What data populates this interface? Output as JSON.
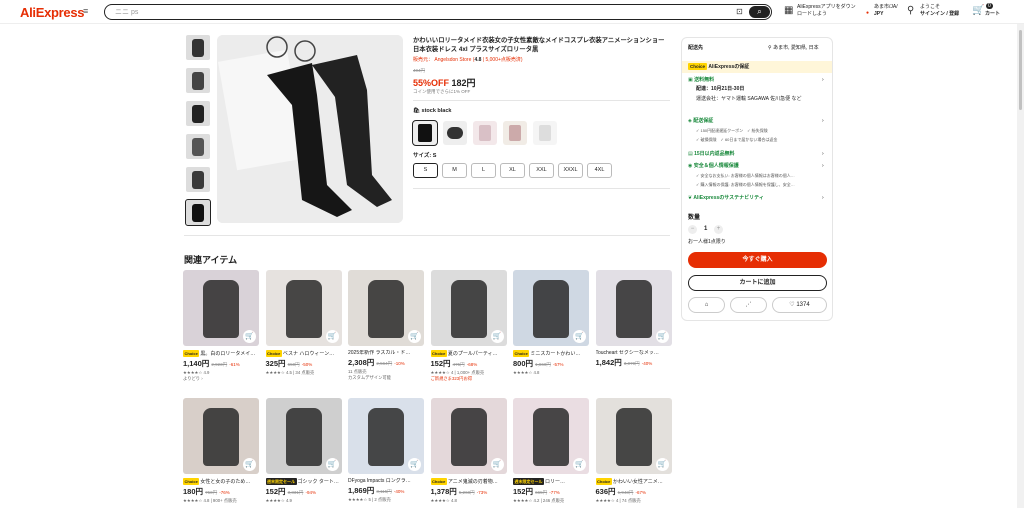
{
  "header": {
    "logo": "AliExpress",
    "search_placeholder": "ニニ ps",
    "app_promo_line1": "AliExpressアプリをダウン",
    "app_promo_line2": "ロードしよう",
    "region_line1": "あま市/JA/",
    "region_line2": "JPY",
    "account_line1": "ようこそ",
    "account_line2": "サインイン / 登録",
    "cart_count": "0",
    "cart_label": "カート"
  },
  "product": {
    "title": "かわいいロリータメイド衣装女の子女性素敵なメイドコスプレ衣装アニメーションショー日本衣装ドレス 4xl プラスサイズロリータ黒",
    "store_prefix": "販売元：",
    "store_name": "Angelsdon Store",
    "rating": "4.8",
    "sold": "5,000+点販売済",
    "original_price": "404円",
    "discount": "55%OFF",
    "price": "182円",
    "coin_note": "コイン使用でさらに1% OFF",
    "color_label": "stock black",
    "size_label": "サイズ: S",
    "sizes": [
      "S",
      "M",
      "L",
      "XL",
      "XXL",
      "XXXL",
      "4XL"
    ]
  },
  "panel": {
    "ship_to_label": "配送先",
    "ship_to_value": "あま市, 愛知県, 日本",
    "choice": "Choice",
    "guarantee": "AliExpressの保証",
    "free_shipping": "送料無料",
    "delivery": "配達：10月21日-30日",
    "carrier": "運送会社：ヤマト運輸 SAGAWA 佐川急便 など",
    "secure_delivery": "配送保証",
    "secure_item1": "150円配達遅延クーポン",
    "secure_item2": "紛失保険",
    "secure_item3": "破損保険",
    "secure_item4": "60日まで届かない場合は返金",
    "returns": "15日以内返品無料",
    "privacy": "安全＆個人情報保護",
    "privacy_item1": "安全なお支払い: お客様の個人情報はお客様の個人…",
    "privacy_item2": "購入情報の保護: お客様の個人情報を保護し、安全…",
    "sustainability": "AliExpressのサステナビリティ",
    "qty_label": "数量",
    "qty_value": "1",
    "limit": "お一人様1点限り",
    "buy_now": "今すぐ購入",
    "add_to_cart": "カートに追加",
    "wishlist_count": "1374"
  },
  "related": {
    "title": "関連アイテム",
    "items": [
      {
        "badge": "Choice",
        "name": "黒。白のロリータメイ…",
        "price": "1,140円",
        "orig": "2,923円",
        "disc": "-61%",
        "meta1": "★★★★☆ 4.9",
        "meta2": "よりどり ›"
      },
      {
        "badge": "Choice",
        "name": "ベスナ ハロウィーン…",
        "price": "325円",
        "orig": "650円",
        "disc": "-50%",
        "meta1": "★★★★☆ 4.5 | 34 点販売",
        "meta2": ""
      },
      {
        "badge": "",
        "name": "2025年新作 ラスカル・ド…",
        "price": "2,308円",
        "orig": "2,564円",
        "disc": "-10%",
        "meta1": "11 点販売",
        "meta2": "カスタムデザイン可能"
      },
      {
        "badge": "Choice",
        "name": "夏のプールパーティ…",
        "price": "152円",
        "orig": "475円",
        "disc": "-68%",
        "meta1": "★★★★☆ 4 | 1,000+ 点販売",
        "meta2": "ご新規さま323円お得"
      },
      {
        "badge": "Choice",
        "name": "ミニスカートかわい…",
        "price": "800円",
        "orig": "1,860円",
        "disc": "-57%",
        "meta1": "★★★★☆ 4.8",
        "meta2": ""
      },
      {
        "badge": "",
        "name": "Toucheart セクシーなメッ…",
        "price": "1,842円",
        "orig": "3,070円",
        "disc": "-40%",
        "meta1": "",
        "meta2": ""
      },
      {
        "badge": "Choice",
        "name": "女性と女の子のため…",
        "price": "180円",
        "orig": "750円",
        "disc": "-76%",
        "meta1": "★★★★☆ 4.8 | 900+ 点販売",
        "meta2": ""
      },
      {
        "badge": "週末限定セール",
        "name": "ゴシック タート…",
        "price": "152円",
        "orig": "3,331円",
        "disc": "-94%",
        "meta1": "★★★★☆ 4.9",
        "meta2": ""
      },
      {
        "badge": "",
        "name": "DFyoga Impacts ロングラ…",
        "price": "1,869円",
        "orig": "3,115円",
        "disc": "-40%",
        "meta1": "★★★★☆ 5 | 2 点販売",
        "meta2": ""
      },
      {
        "badge": "Choice",
        "name": "アニメ鬼滅の刃着物…",
        "price": "1,378円",
        "orig": "5,268円",
        "disc": "-73%",
        "meta1": "★★★★☆ 4.8",
        "meta2": ""
      },
      {
        "badge": "週末限定セール",
        "name": "ロリー…",
        "price": "152円",
        "orig": "665円",
        "disc": "-77%",
        "meta1": "★★★★☆ 4.2 | 246 点販売",
        "meta2": ""
      },
      {
        "badge": "Choice",
        "name": "かわいい女性アニメ…",
        "price": "636円",
        "orig": "1,943円",
        "disc": "-67%",
        "meta1": "★★★★☆ 4 | 74 点販売",
        "meta2": ""
      }
    ]
  }
}
